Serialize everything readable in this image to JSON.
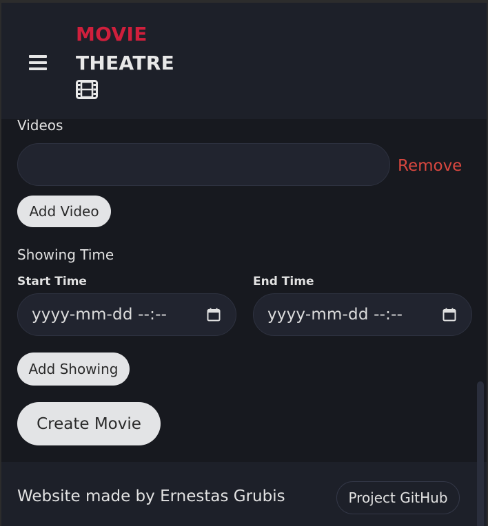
{
  "header": {
    "brand_line1": "MOVIE",
    "brand_line2": "THEATRE",
    "menu_icon": "hamburger-menu-icon",
    "logo_icon": "film-icon",
    "brand_accent": "#d01f3c"
  },
  "videos": {
    "label": "Videos",
    "input_value": "",
    "remove_label": "Remove",
    "add_label": "Add Video"
  },
  "showing": {
    "label": "Showing Time",
    "start_label": "Start Time",
    "end_label": "End Time",
    "start_placeholder": "yyyy-mm-dd --:--",
    "end_placeholder": "yyyy-mm-dd --:--",
    "calendar_icon": "calendar-icon",
    "add_label": "Add Showing"
  },
  "form": {
    "submit_label": "Create Movie"
  },
  "footer": {
    "credit": "Website made by Ernestas Grubis",
    "github_label": "Project GitHub"
  }
}
